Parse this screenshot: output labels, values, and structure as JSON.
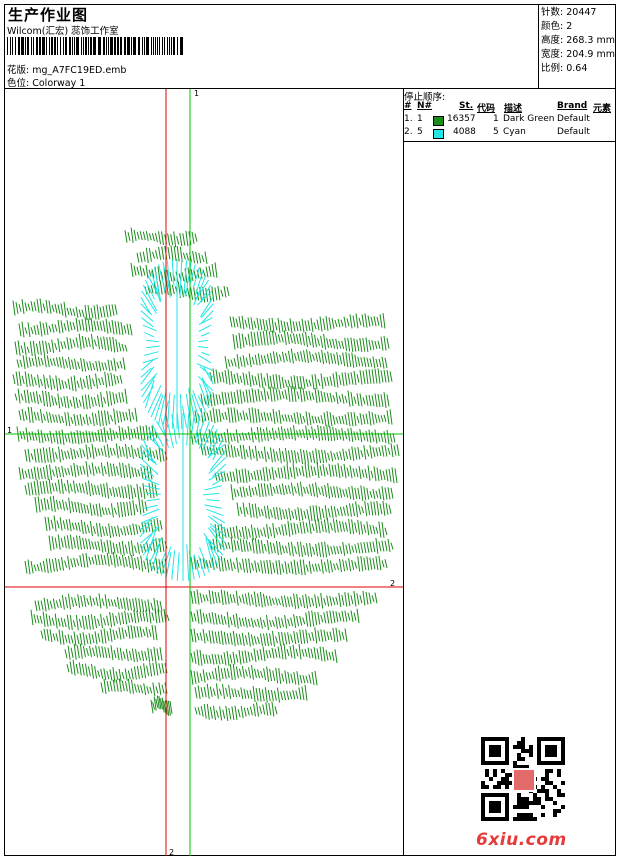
{
  "header": {
    "title": "生产作业图",
    "studio": "Wilcom(汇宏) 蕊饰工作室",
    "filename_label": "花版:",
    "filename": "mg_A7FC19ED.emb",
    "colorway_label": "色位:",
    "colorway": "Colorway 1"
  },
  "stats": [
    {
      "label": "针数:",
      "value": "20447"
    },
    {
      "label": "颜色:",
      "value": "2"
    },
    {
      "label": "高度:",
      "value": "268.3 mm"
    },
    {
      "label": "宽度:",
      "value": "204.9 mm"
    },
    {
      "label": "比例:",
      "value": "0.64"
    }
  ],
  "stop_sequence": {
    "title": "停止顺序:",
    "headers": [
      "#",
      "N#",
      "St.",
      "代码",
      "描述",
      "Brand",
      "元素"
    ],
    "rows": [
      {
        "index": "1.",
        "needle": "1",
        "color": "#1a8c1a",
        "stitches": "16357",
        "code": "1",
        "desc": "Dark Green",
        "brand": "Default"
      },
      {
        "index": "2.",
        "needle": "5",
        "color": "#22e6e6",
        "stitches": "4088",
        "code": "5",
        "desc": "Cyan",
        "brand": "Default"
      }
    ]
  },
  "canvas": {
    "axis_labels": {
      "green_top": "1",
      "green_left": "1",
      "red_right": "2",
      "red_bottom": "2"
    },
    "colors": {
      "red_axis": "#e00000",
      "green_axis": "#00c000",
      "thread_green": "#1a8c1a",
      "thread_cyan": "#22e6e6"
    }
  },
  "watermark": {
    "qr_icon": "qr-code-icon",
    "brand": "6xiu.com"
  }
}
